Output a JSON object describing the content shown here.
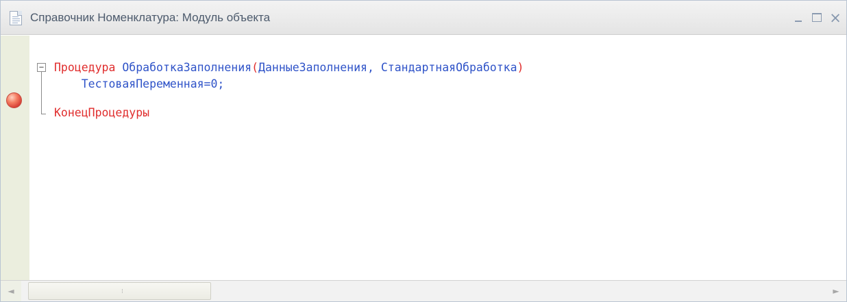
{
  "window": {
    "title": "Справочник Номенклатура: Модуль объекта",
    "icon": "document-icon",
    "controls": {
      "minimize": "minimize-icon",
      "maximize": "maximize-icon",
      "close": "×"
    }
  },
  "code": {
    "line1": {
      "keyword": "Процедура",
      "name": "ОбработкаЗаполнения",
      "open": "(",
      "params": "ДанныеЗаполнения, СтандартнаяОбработка",
      "close": ")"
    },
    "line2": {
      "statement": "ТестоваяПеременная=0;"
    },
    "line3": {
      "keyword": "КонецПроцедуры"
    }
  },
  "colors": {
    "keyword": "#e02d2d",
    "identifier": "#2f53c8",
    "gutter": "#ebeede",
    "breakpoint": "#d9443a"
  },
  "scrollbar": {
    "left_arrow": "◄",
    "right_arrow": "►"
  }
}
